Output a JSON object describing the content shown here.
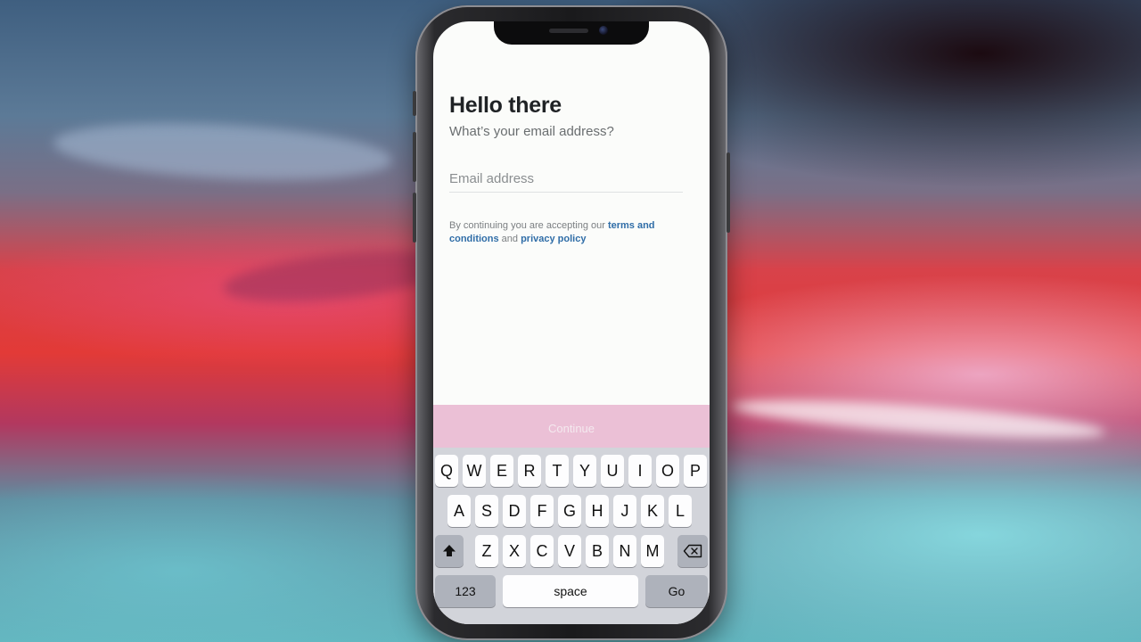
{
  "screen": {
    "title": "Hello there",
    "subtitle": "What’s your email address?",
    "email_field": {
      "placeholder": "Email address",
      "value": ""
    },
    "terms": {
      "prefix": "By continuing you are accepting our ",
      "terms_link": "terms and conditions",
      "middle": " and ",
      "privacy_link": "privacy policy"
    },
    "continue_label": "Continue"
  },
  "keyboard": {
    "row1": [
      "Q",
      "W",
      "E",
      "R",
      "T",
      "Y",
      "U",
      "I",
      "O",
      "P"
    ],
    "row2": [
      "A",
      "S",
      "D",
      "F",
      "G",
      "H",
      "J",
      "K",
      "L"
    ],
    "row3": [
      "Z",
      "X",
      "C",
      "V",
      "B",
      "N",
      "M"
    ],
    "numbers_label": "123",
    "space_label": "space",
    "go_label": "Go",
    "shift_icon": "shift-arrow-icon",
    "delete_icon": "backspace-icon"
  },
  "colors": {
    "accent_link": "#2f6da7",
    "continue_bg": "#ebc0d6",
    "keyboard_bg": "#d2d4da"
  }
}
